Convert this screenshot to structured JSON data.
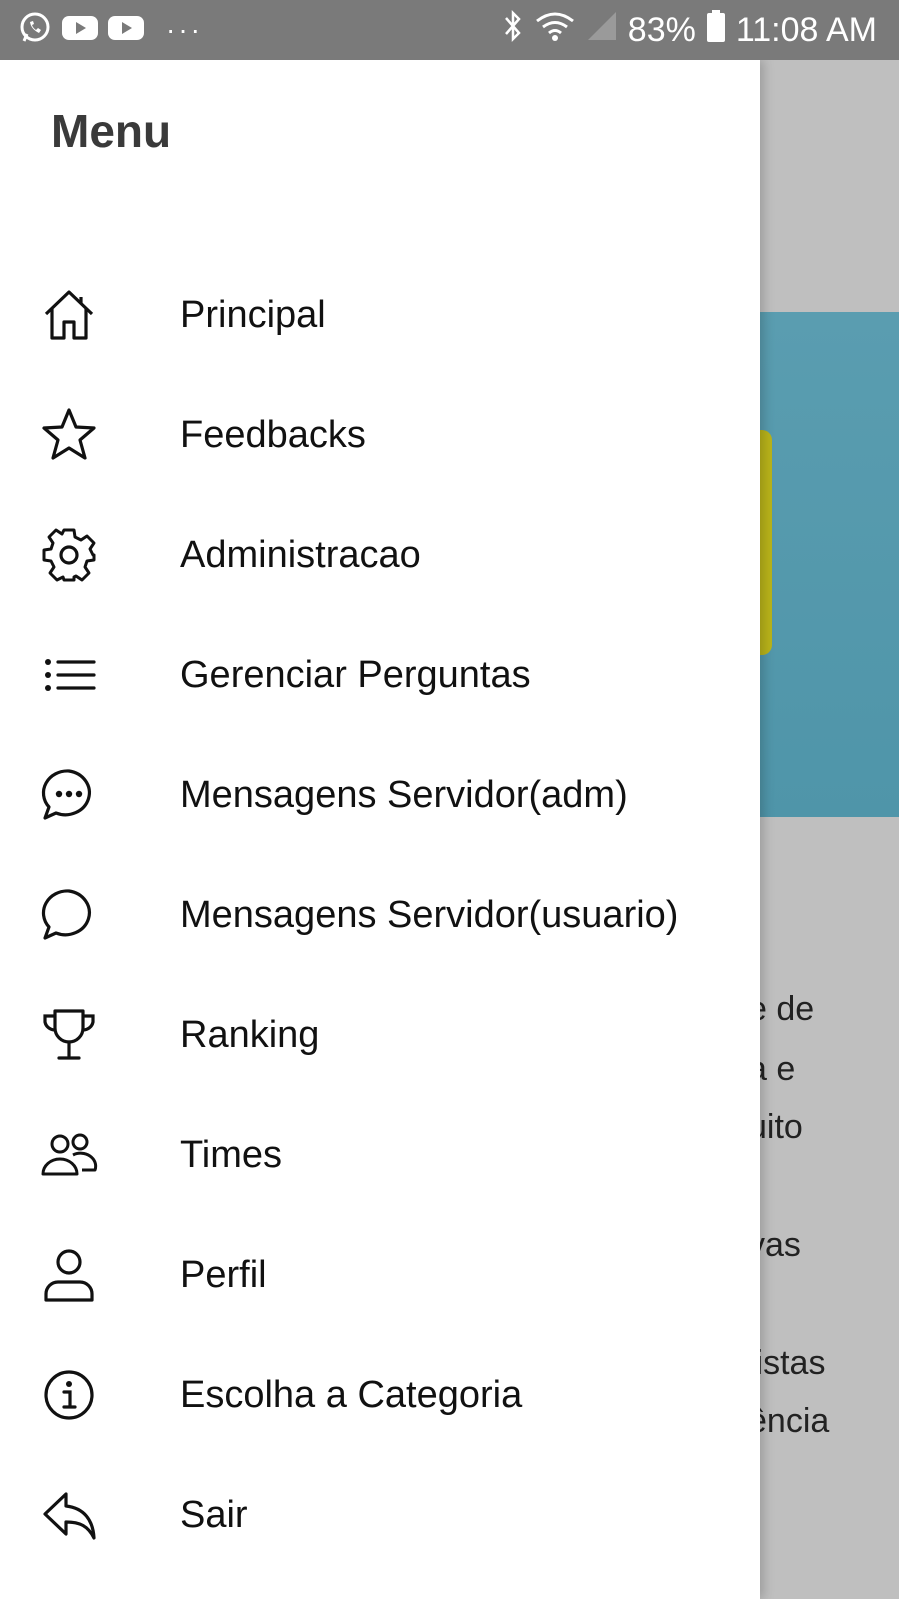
{
  "status_bar": {
    "battery": "83%",
    "time": "11:08 AM",
    "left_icons": [
      "whatsapp-icon",
      "youtube-icon",
      "youtube-icon"
    ],
    "more": "···",
    "right_icons": [
      "bluetooth-icon",
      "wifi-icon",
      "signal-icon",
      "battery-icon"
    ]
  },
  "drawer": {
    "title": "Menu",
    "items": [
      {
        "label": "Principal",
        "icon": "home-icon"
      },
      {
        "label": "Feedbacks",
        "icon": "star-icon"
      },
      {
        "label": "Administracao",
        "icon": "gear-icon"
      },
      {
        "label": "Gerenciar Perguntas",
        "icon": "list-icon"
      },
      {
        "label": "Mensagens Servidor(adm)",
        "icon": "chat-dots-icon"
      },
      {
        "label": "Mensagens Servidor(usuario)",
        "icon": "chat-bubble-icon"
      },
      {
        "label": "Ranking",
        "icon": "trophy-icon"
      },
      {
        "label": "Times",
        "icon": "people-icon"
      },
      {
        "label": "Perfil",
        "icon": "person-icon"
      },
      {
        "label": "Escolha a Categoria",
        "icon": "info-icon"
      },
      {
        "label": "Sair",
        "icon": "reply-icon"
      }
    ]
  },
  "background": {
    "text_fragments": [
      "e de",
      "a e",
      "uito",
      "vas",
      "listas",
      "ência"
    ]
  },
  "colors": {
    "status_bar": "#7a7a7a",
    "scrim": "#bdbdbd",
    "drawer": "#ffffff",
    "image_blue": "#5a9db0",
    "image_yellow": "#b8b31a"
  }
}
